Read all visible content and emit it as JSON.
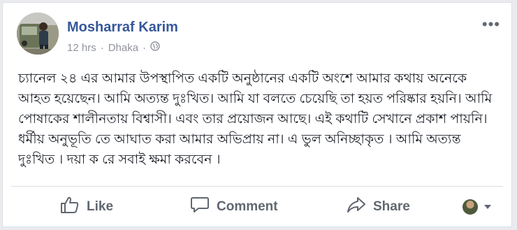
{
  "post": {
    "author": "Mosharraf Karim",
    "time": "12 hrs",
    "separator": "·",
    "location": "Dhaka",
    "separator2": "·",
    "privacy_icon": "globe-icon",
    "more_icon": "•••",
    "text": "চ্যানেল ২৪ এর আমার উপস্থাপিত একটি অনুষ্ঠানের একটি অংশে আমার কথায় অনেকে আহত হয়েছেন। আমি অত্যন্ত দুঃখিত। আমি যা বলতে চেয়েছি তা হয়ত পরিষ্কার হয়নি। আমি পোষাকের শালীনতায় বিশ্বাসী। এবং তার প্রয়োজন আছে। এই কথাটি সেখানে প্রকাশ পায়নি। ধর্মীয় অনুভূতি তে আঘাত করা আমার অভিপ্রায় না। এ ভুল অনিচ্ছাকৃত । আমি অত্যন্ত দুঃখিত । দয়া ক রে সবাই ক্ষমা করবেন ।"
  },
  "actions": {
    "like": "Like",
    "comment": "Comment",
    "share": "Share"
  },
  "colors": {
    "author": "#365899",
    "meta": "#90949c",
    "action": "#606770",
    "text": "#1d2129"
  }
}
